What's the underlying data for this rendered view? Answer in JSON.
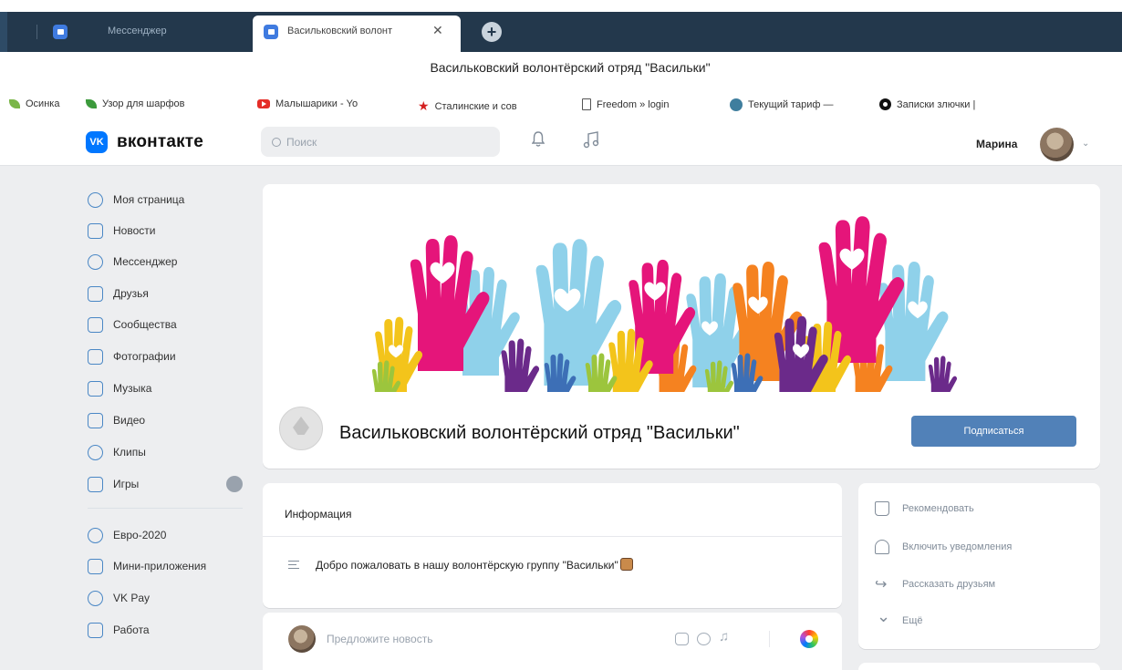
{
  "browser": {
    "tabs": [
      {
        "label": "Мессенджер",
        "active": false
      },
      {
        "label": "Васильковский волонт",
        "active": true
      }
    ],
    "close_symbol": "✕",
    "new_tab_symbol": "+",
    "page_title": "Васильковский волонтёрский отряд \"Васильки\"",
    "bookmarks": [
      {
        "label": "Осинка",
        "icon": "leaf-icon"
      },
      {
        "label": "Узор для шарфов",
        "icon": "leaf-icon"
      },
      {
        "label": "Малышарики - Yo",
        "icon": "youtube-icon"
      },
      {
        "label": "Сталинские и сов",
        "icon": "star-icon"
      },
      {
        "label": "Freedom » login",
        "icon": "document-icon"
      },
      {
        "label": "Текущий тариф —",
        "icon": "wordpress-icon"
      },
      {
        "label": "Записки злючки |",
        "icon": "circle-icon"
      }
    ]
  },
  "header": {
    "logo_mark": "VK",
    "logo_text": "вконтакте",
    "search_placeholder": "Поиск",
    "user_name": "Марина",
    "colors": {
      "accent": "#0077ff",
      "button": "#5181b8"
    }
  },
  "nav": {
    "items": [
      {
        "label": "Моя страница",
        "icon": "user-circle-icon"
      },
      {
        "label": "Новости",
        "icon": "news-icon"
      },
      {
        "label": "Мессенджер",
        "icon": "message-icon"
      },
      {
        "label": "Друзья",
        "icon": "friends-icon"
      },
      {
        "label": "Сообщества",
        "icon": "communities-icon"
      },
      {
        "label": "Фотографии",
        "icon": "photo-icon"
      },
      {
        "label": "Музыка",
        "icon": "music-icon"
      },
      {
        "label": "Видео",
        "icon": "video-icon"
      },
      {
        "label": "Клипы",
        "icon": "clips-icon"
      },
      {
        "label": "Игры",
        "icon": "games-icon"
      }
    ],
    "items2": [
      {
        "label": "Евро-2020",
        "icon": "football-icon"
      },
      {
        "label": "Мини-приложения",
        "icon": "apps-icon"
      },
      {
        "label": "VK Pay",
        "icon": "vkpay-icon"
      },
      {
        "label": "Работа",
        "icon": "work-icon"
      }
    ]
  },
  "group": {
    "name": "Васильковский волонтёрский отряд \"Васильки\"",
    "subscribe_label": "Подписаться"
  },
  "info": {
    "title": "Информация",
    "description": "Добро пожаловать в нашу волонтёрскую группу \"Васильки\""
  },
  "post": {
    "placeholder": "Предложите новость"
  },
  "actions": [
    {
      "label": "Рекомендовать",
      "icon": "like-icon"
    },
    {
      "label": "Включить уведомления",
      "icon": "bell-icon"
    },
    {
      "label": "Рассказать друзьям",
      "icon": "share-icon"
    },
    {
      "label": "Ещё",
      "icon": "chevron-down-icon"
    }
  ]
}
